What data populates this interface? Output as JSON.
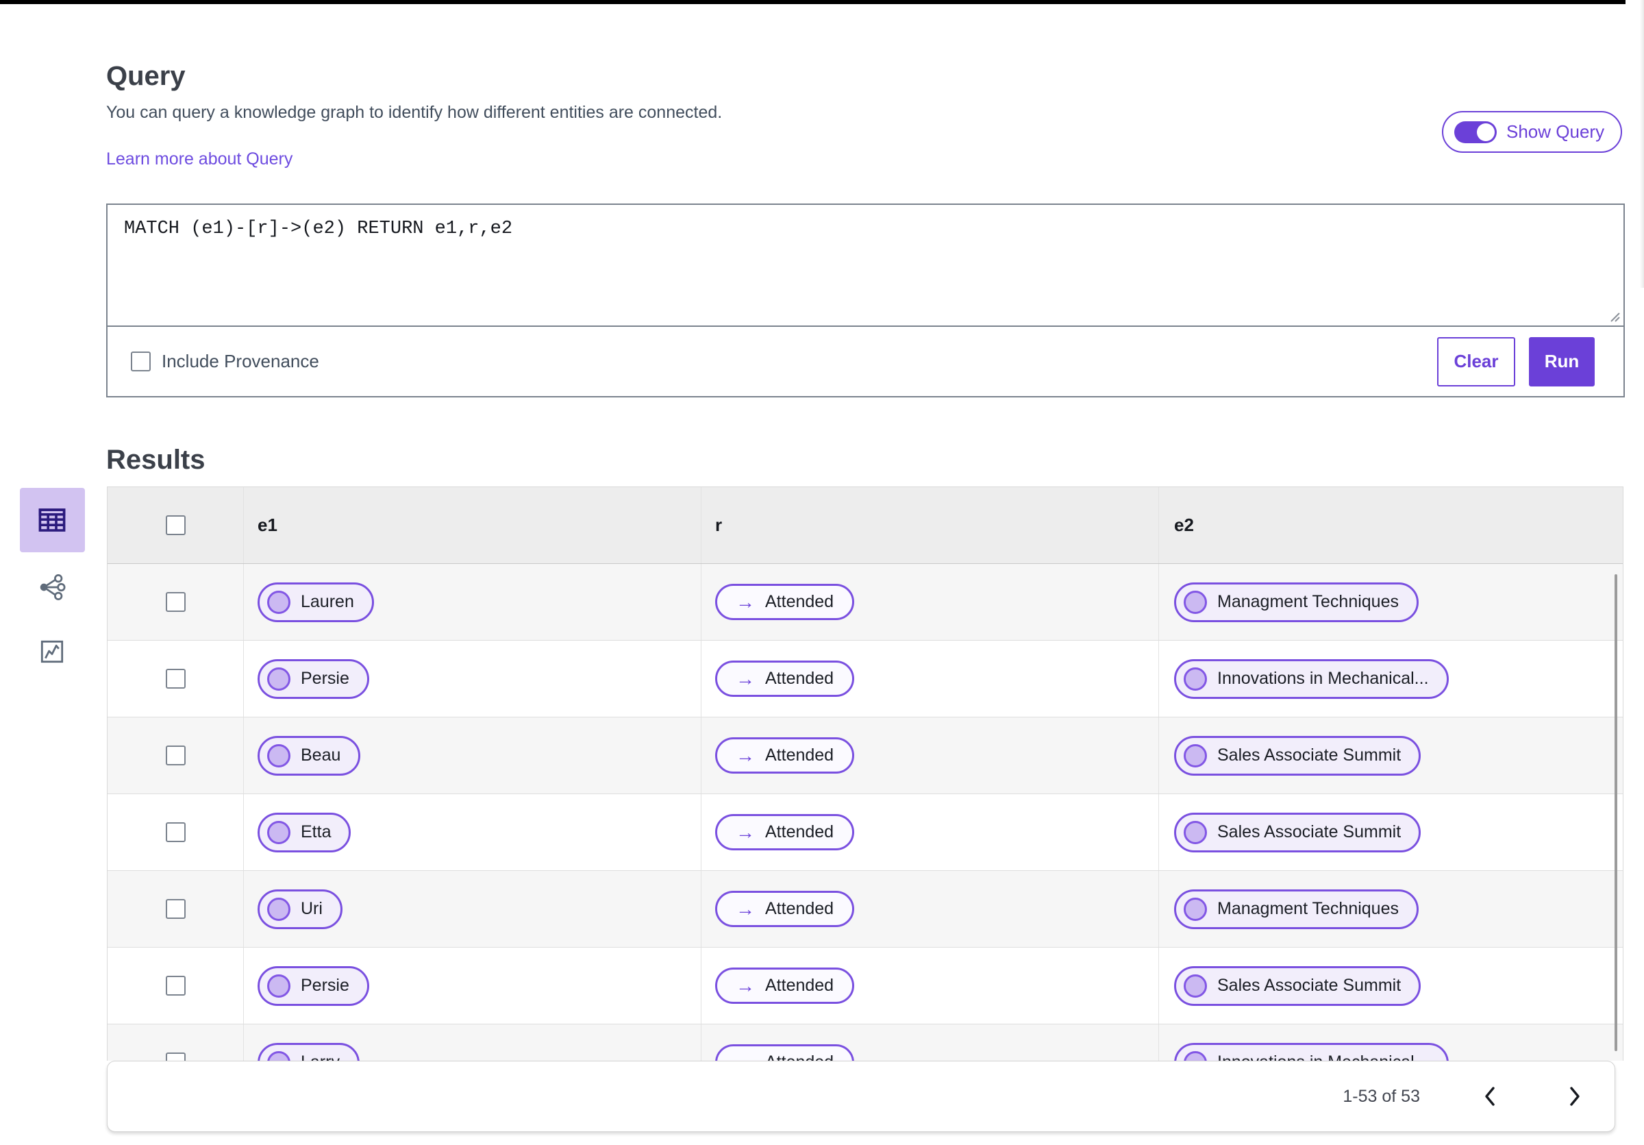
{
  "colors": {
    "accent": "#6b40d8",
    "pill_border": "#7a50e0",
    "link": "#6d4be0",
    "selected_view_bg": "#d2c3f1"
  },
  "query_section": {
    "title": "Query",
    "description": "You can query a knowledge graph to identify how different entities are connected.",
    "learn_more_link": "Learn more about Query",
    "show_query_toggle": {
      "label": "Show Query",
      "state": "on"
    },
    "editor": {
      "query_text": "MATCH (e1)-[r]->(e2) RETURN e1,r,e2"
    },
    "include_provenance": {
      "label": "Include Provenance",
      "checked": false
    },
    "buttons": {
      "clear": "Clear",
      "run": "Run"
    }
  },
  "results_section": {
    "title": "Results",
    "view_switcher": {
      "items": [
        {
          "name": "table-view",
          "selected": true
        },
        {
          "name": "graph-view",
          "selected": false
        },
        {
          "name": "chart-view",
          "selected": false
        }
      ]
    },
    "table": {
      "columns": [
        "e1",
        "r",
        "e2"
      ],
      "relation_arrow": "→",
      "rows": [
        {
          "e1": "Lauren",
          "r": "Attended",
          "e2": "Managment Techniques"
        },
        {
          "e1": "Persie",
          "r": "Attended",
          "e2": "Innovations in Mechanical..."
        },
        {
          "e1": "Beau",
          "r": "Attended",
          "e2": "Sales Associate Summit"
        },
        {
          "e1": "Etta",
          "r": "Attended",
          "e2": "Sales Associate Summit"
        },
        {
          "e1": "Uri",
          "r": "Attended",
          "e2": "Managment Techniques"
        },
        {
          "e1": "Persie",
          "r": "Attended",
          "e2": "Sales Associate Summit"
        },
        {
          "e1": "Larry",
          "r": "Attended",
          "e2": "Innovations in Mechanical..."
        }
      ]
    },
    "pagination": {
      "range_label": "1-53 of 53"
    }
  }
}
